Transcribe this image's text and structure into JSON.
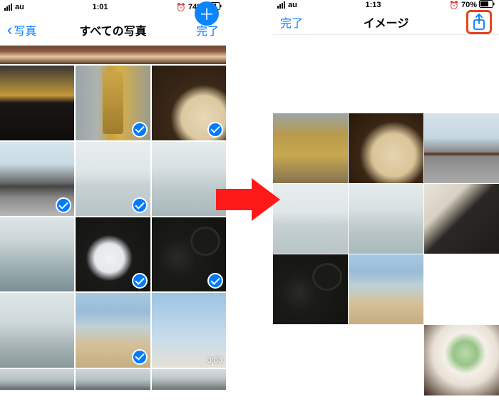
{
  "left": {
    "status": {
      "carrier": "au",
      "time": "1:01",
      "battery_pct": "74%"
    },
    "nav": {
      "back_label": "写真",
      "title": "すべての写真",
      "done_label": "完了"
    },
    "photos": [
      {
        "name": "row0-crop",
        "style": "t-crop",
        "selected": false
      },
      {
        "name": "beer-black",
        "style": "t-beer2",
        "selected": false
      },
      {
        "name": "beer-premium-can",
        "style": "t-can",
        "selected": true
      },
      {
        "name": "soba-noodles",
        "style": "t-soba",
        "selected": true
      },
      {
        "name": "station-glass-roof",
        "style": "t-station",
        "selected": true
      },
      {
        "name": "sea-horizon-1",
        "style": "t-sea1",
        "selected": true
      },
      {
        "name": "sea-horizon-2",
        "style": "t-sea2",
        "selected": false
      },
      {
        "name": "sea-dark",
        "style": "t-sea3",
        "selected": false
      },
      {
        "name": "meal-tray-white",
        "style": "t-tray1",
        "selected": true
      },
      {
        "name": "meal-tray-urchin",
        "style": "t-tray2",
        "selected": true
      },
      {
        "name": "sea-horizon-3",
        "style": "t-sea4",
        "selected": false
      },
      {
        "name": "beach-sand",
        "style": "t-beach",
        "selected": true
      },
      {
        "name": "sky-video",
        "style": "t-sky",
        "selected": false,
        "duration": "0:03"
      },
      {
        "name": "bottom-crop-1",
        "style": "t-people",
        "selected": false
      },
      {
        "name": "bottom-crop-2",
        "style": "t-people",
        "selected": false
      },
      {
        "name": "bottom-crop-3",
        "style": "t-house",
        "selected": false
      }
    ]
  },
  "right": {
    "status": {
      "carrier": "au",
      "time": "1:13",
      "battery_pct": "70%"
    },
    "nav": {
      "done_label": "完了",
      "title": "イメージ"
    },
    "photos": [
      {
        "name": "can",
        "style": "t-can2"
      },
      {
        "name": "soba",
        "style": "t-soba2"
      },
      {
        "name": "station-gate",
        "style": "t-gate"
      },
      {
        "name": "sea",
        "style": "t-sea1"
      },
      {
        "name": "sea-2",
        "style": "t-sea2"
      },
      {
        "name": "sashimi",
        "style": "t-sashimi"
      },
      {
        "name": "urchin-tray",
        "style": "t-tray2"
      },
      {
        "name": "beach",
        "style": "t-beach"
      },
      {
        "name": "old-street",
        "style": "t-street",
        "wide": true
      },
      {
        "name": "mochi-matcha",
        "style": "t-mochi"
      }
    ]
  },
  "colors": {
    "ios_blue": "#007aff",
    "highlight_red": "#e8441a"
  }
}
